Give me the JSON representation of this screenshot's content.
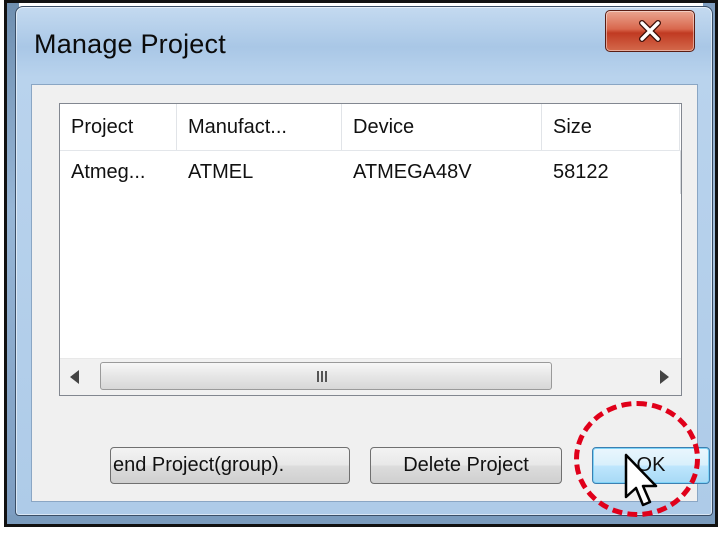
{
  "window": {
    "title": "Manage Project",
    "close_icon": "close-icon"
  },
  "project_list": {
    "columns": [
      "Project",
      "Manufact...",
      "Device",
      "Size"
    ],
    "rows": [
      {
        "project": "Atmeg...",
        "manufacturer": "ATMEL",
        "device": "ATMEGA48V",
        "size": "58122"
      }
    ],
    "scrollbar_grip": "III"
  },
  "buttons": {
    "append_label": "end Project(group).",
    "delete_label": "Delete Project",
    "ok_label": "OK"
  },
  "colors": {
    "close_button": "#c74a2f",
    "highlight": "#e0001a",
    "ok_focus": "#3c7fb1"
  }
}
